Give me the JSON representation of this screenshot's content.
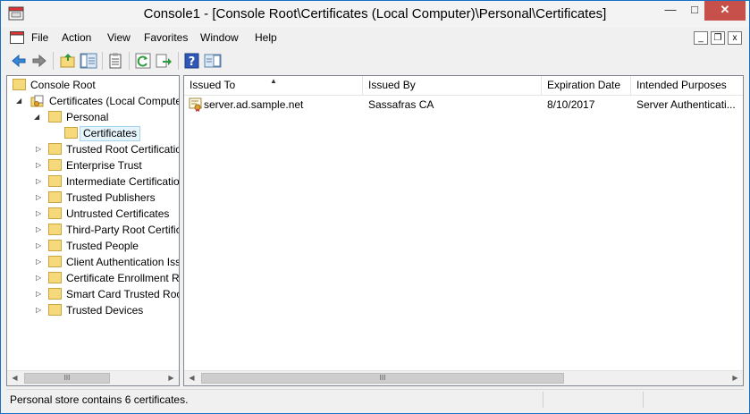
{
  "window": {
    "title": "Console1 - [Console Root\\Certificates (Local Computer)\\Personal\\Certificates]",
    "min_glyph": "—",
    "max_glyph": "□",
    "close_glyph": "✕"
  },
  "menu": {
    "items": [
      "File",
      "Action",
      "View",
      "Favorites",
      "Window",
      "Help"
    ]
  },
  "mdi": {
    "min_glyph": "_",
    "restore_glyph": "❐",
    "close_glyph": "x"
  },
  "toolbar": {
    "icons": [
      "back-icon",
      "forward-icon",
      "up-folder-icon",
      "show-hide-tree-icon",
      "properties-icon",
      "refresh-icon",
      "export-list-icon",
      "help-icon",
      "show-hide-action-pane-icon"
    ]
  },
  "tree": {
    "root": "Console Root",
    "certificates_node": "Certificates (Local Compute",
    "personal": "Personal",
    "selected": "Certificates",
    "stores": [
      "Trusted Root Certification",
      "Enterprise Trust",
      "Intermediate Certification",
      "Trusted Publishers",
      "Untrusted Certificates",
      "Third-Party Root Certific",
      "Trusted People",
      "Client Authentication Iss",
      "Certificate Enrollment R",
      "Smart Card Trusted Roo",
      "Trusted Devices"
    ]
  },
  "list": {
    "columns": [
      "Issued To",
      "Issued By",
      "Expiration Date",
      "Intended Purposes"
    ],
    "rows": [
      [
        "server.ad.sample.net",
        "Sassafras CA",
        "8/10/2017",
        "Server Authenticati..."
      ]
    ]
  },
  "scrollbar": {
    "left_arrow": "◀",
    "right_arrow": "▶",
    "thumb_grip": "III"
  },
  "status": {
    "text": "Personal store contains 6 certificates."
  },
  "colors": {
    "title_border": "#1a70c0",
    "close_button": "#c7504b",
    "folder": "#f5d97b",
    "selection": "#e5f3fb"
  }
}
